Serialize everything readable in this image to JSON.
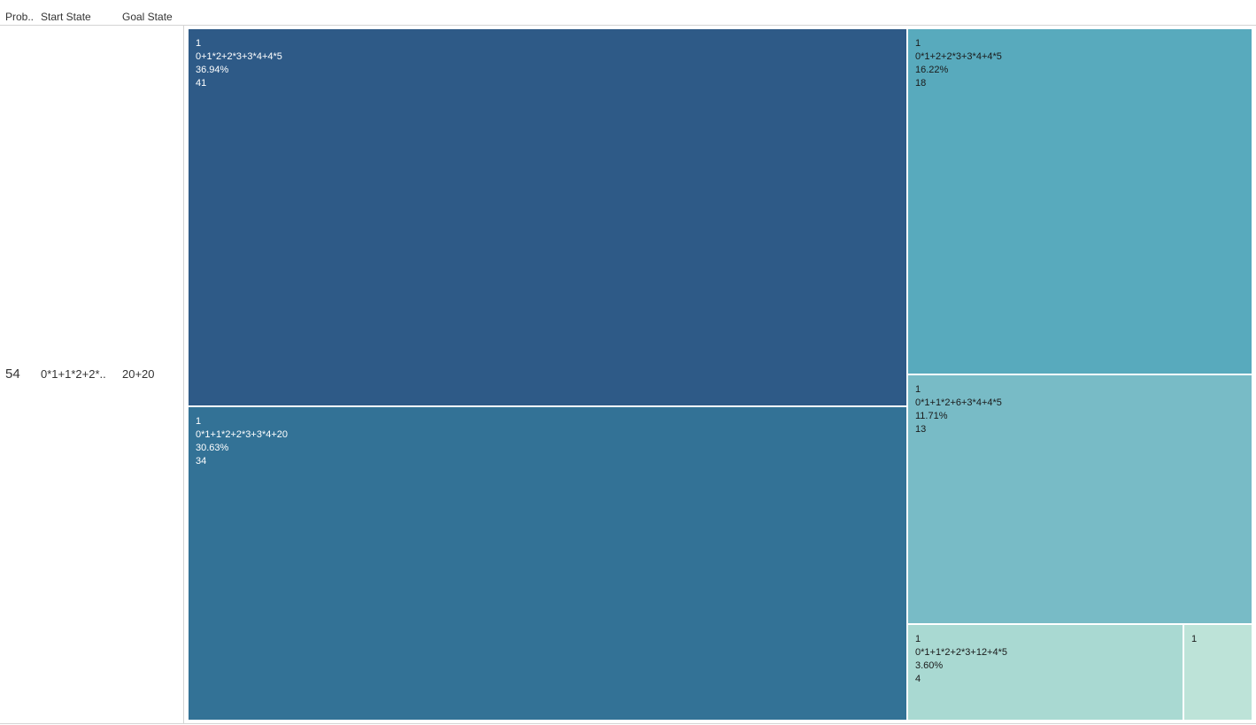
{
  "header": {
    "col1": "Prob..",
    "col2": "Start State",
    "col3": "Goal State"
  },
  "row": {
    "prob": "54",
    "start_state": "0*1+1*2+2*..",
    "goal_state": "20+20"
  },
  "chart_data": {
    "type": "treemap",
    "tiles": [
      {
        "label1": "1",
        "label2": "0+1*2+2*3+3*4+4*5",
        "percent": "36.94%",
        "value": 41,
        "color": "#2e5a87",
        "text_color": "#ffffff"
      },
      {
        "label1": "1",
        "label2": "0*1+1*2+2*3+3*4+20",
        "percent": "30.63%",
        "value": 34,
        "color": "#337296",
        "text_color": "#ffffff"
      },
      {
        "label1": "1",
        "label2": "0*1+2+2*3+3*4+4*5",
        "percent": "16.22%",
        "value": 18,
        "color": "#58aabd",
        "text_color": "#1a1a1a"
      },
      {
        "label1": "1",
        "label2": "0*1+1*2+6+3*4+4*5",
        "percent": "11.71%",
        "value": 13,
        "color": "#78bbc6",
        "text_color": "#1a1a1a"
      },
      {
        "label1": "1",
        "label2": "0*1+1*2+2*3+12+4*5",
        "percent": "3.60%",
        "value": 4,
        "color": "#a9d9d2",
        "text_color": "#1a1a1a"
      },
      {
        "label1": "1",
        "label2": "",
        "percent": "",
        "value": 1,
        "color": "#bde3d8",
        "text_color": "#1a1a1a"
      }
    ]
  }
}
